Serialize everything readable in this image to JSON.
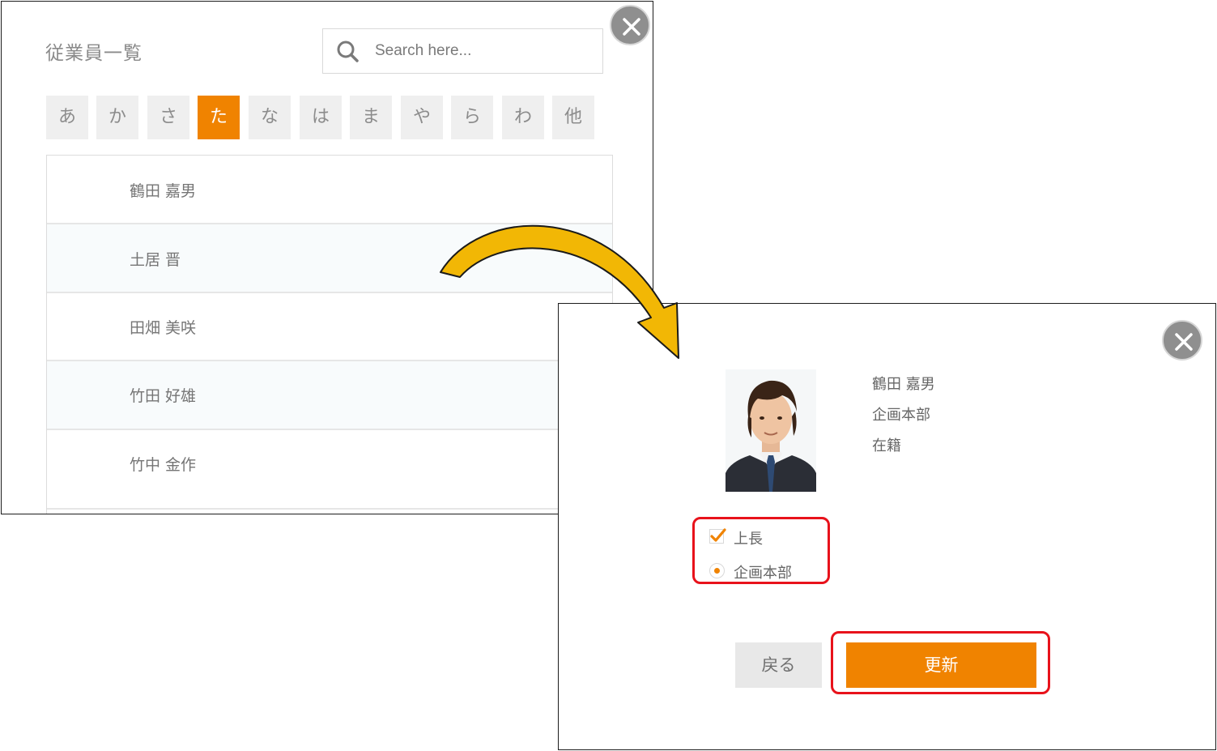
{
  "list_panel": {
    "title": "従業員一覧",
    "search_placeholder": "Search here...",
    "kana_tabs": [
      "あ",
      "か",
      "さ",
      "た",
      "な",
      "は",
      "ま",
      "や",
      "ら",
      "わ",
      "他"
    ],
    "active_tab": "た",
    "employees": [
      "鶴田 嘉男",
      "土居 晋",
      "田畑 美咲",
      "竹田 好雄",
      "竹中 金作"
    ]
  },
  "detail_panel": {
    "name": "鶴田 嘉男",
    "department": "企画本部",
    "status": "在籍",
    "option_checkbox_label": "上長",
    "option_checkbox_checked": true,
    "option_radio_label": "企画本部",
    "option_radio_selected": true,
    "back_label": "戻る",
    "update_label": "更新"
  },
  "colors": {
    "accent": "#f08300",
    "highlight": "#e8121b",
    "arrow_fill": "#f2b705"
  }
}
